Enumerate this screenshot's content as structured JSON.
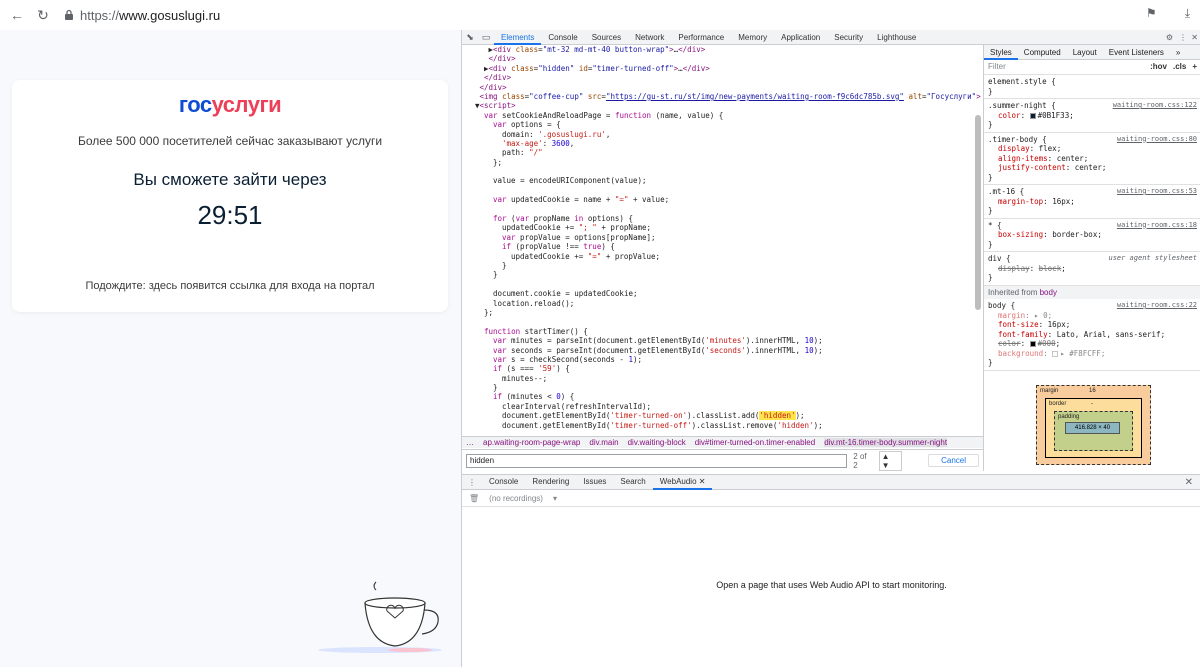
{
  "browser": {
    "url_protocol": "https://",
    "url_host": "www.gosuslugi.ru"
  },
  "page": {
    "logo_part1": "гос",
    "logo_part2": "услуги",
    "visitors_text": "Более 500 000 посетителей сейчас заказывают услуги",
    "enter_title": "Вы сможете зайти через",
    "timer": "29:51",
    "wait_text": "Подождите: здесь появится ссылка для входа на портал"
  },
  "devtools": {
    "tabs": [
      "Elements",
      "Console",
      "Sources",
      "Network",
      "Performance",
      "Memory",
      "Application",
      "Security",
      "Lighthouse"
    ],
    "active_tab": "Elements",
    "code_lines": [
      {
        "indent": 5,
        "html": "<span class=\"gt\">▶</span><span class=\"tag\">&lt;div</span> <span class=\"attr\">class</span>=<span class=\"val\">\"mt-32 md-mt-40 button-wrap\"</span><span class=\"tag\">&gt;</span>…<span class=\"tag\">&lt;/div&gt;</span>"
      },
      {
        "indent": 5,
        "html": "<span class=\"tag\">&lt;/div&gt;</span>"
      },
      {
        "indent": 4,
        "html": "<span class=\"gt\">▶</span><span class=\"tag\">&lt;div</span> <span class=\"attr\">class</span>=<span class=\"val\">\"hidden\"</span> <span class=\"attr\">id</span>=<span class=\"val\">\"timer-turned-off\"</span><span class=\"tag\">&gt;</span>…<span class=\"tag\">&lt;/div&gt;</span>"
      },
      {
        "indent": 4,
        "html": "<span class=\"tag\">&lt;/div&gt;</span>"
      },
      {
        "indent": 3,
        "html": "<span class=\"tag\">&lt;/div&gt;</span>"
      },
      {
        "indent": 3,
        "html": "<span class=\"tag\">&lt;img</span> <span class=\"attr\">class</span>=<span class=\"val\">\"coffee-cup\"</span> <span class=\"attr\">src</span>=<span class=\"val\"><u>\"https://gu-st.ru/st/img/new-payments/waiting-room-f9c6dc785b.svg\"</u></span> <span class=\"attr\">alt</span>=<span class=\"val\">\"Госуслуги\"</span><span class=\"tag\">&gt;</span>"
      },
      {
        "indent": 2,
        "html": "▼<span class=\"tag\">&lt;script&gt;</span>"
      },
      {
        "indent": 4,
        "html": "<span class=\"kw\">var</span> setCookieAndReloadPage = <span class=\"kw\">function</span> (name, value) {"
      },
      {
        "indent": 6,
        "html": "<span class=\"kw\">var</span> options = {"
      },
      {
        "indent": 8,
        "html": "domain: <span class=\"str\">'.gosuslugi.ru'</span>,"
      },
      {
        "indent": 8,
        "html": "<span class=\"str\">'max-age'</span>: <span class=\"num\">3600</span>,"
      },
      {
        "indent": 8,
        "html": "path: <span class=\"str\">\"/\"</span>"
      },
      {
        "indent": 6,
        "html": "};"
      },
      {
        "indent": 0,
        "html": ""
      },
      {
        "indent": 6,
        "html": "value = encodeURIComponent(value);"
      },
      {
        "indent": 0,
        "html": ""
      },
      {
        "indent": 6,
        "html": "<span class=\"kw\">var</span> updatedCookie = name + <span class=\"str\">\"=\"</span> + value;"
      },
      {
        "indent": 0,
        "html": ""
      },
      {
        "indent": 6,
        "html": "<span class=\"kw\">for</span> (<span class=\"kw\">var</span> propName <span class=\"kw\">in</span> options) {"
      },
      {
        "indent": 8,
        "html": "updatedCookie += <span class=\"str\">\"; \"</span> + propName;"
      },
      {
        "indent": 8,
        "html": "<span class=\"kw\">var</span> propValue = options[propName];"
      },
      {
        "indent": 8,
        "html": "<span class=\"kw\">if</span> (propValue !== <span class=\"kw\">true</span>) {"
      },
      {
        "indent": 10,
        "html": "updatedCookie += <span class=\"str\">\"=\"</span> + propValue;"
      },
      {
        "indent": 8,
        "html": "}"
      },
      {
        "indent": 6,
        "html": "}"
      },
      {
        "indent": 0,
        "html": ""
      },
      {
        "indent": 6,
        "html": "document.cookie = updatedCookie;"
      },
      {
        "indent": 6,
        "html": "location.reload();"
      },
      {
        "indent": 4,
        "html": "};"
      },
      {
        "indent": 0,
        "html": ""
      },
      {
        "indent": 4,
        "html": "<span class=\"kw\">function</span> startTimer() {"
      },
      {
        "indent": 6,
        "html": "<span class=\"kw\">var</span> minutes = parseInt(document.getElementById(<span class=\"str\">'minutes'</span>).innerHTML, <span class=\"num\">10</span>);"
      },
      {
        "indent": 6,
        "html": "<span class=\"kw\">var</span> seconds = parseInt(document.getElementById(<span class=\"str\">'seconds'</span>).innerHTML, <span class=\"num\">10</span>);"
      },
      {
        "indent": 6,
        "html": "<span class=\"kw\">var</span> s = checkSecond(seconds - <span class=\"num\">1</span>);"
      },
      {
        "indent": 6,
        "html": "<span class=\"kw\">if</span> (s === <span class=\"str\">'59'</span>) {"
      },
      {
        "indent": 8,
        "html": "minutes--;"
      },
      {
        "indent": 6,
        "html": "}"
      },
      {
        "indent": 6,
        "html": "<span class=\"kw\">if</span> (minutes &lt; <span class=\"num\">0</span>) {"
      },
      {
        "indent": 8,
        "html": "clearInterval(refreshIntervalId);"
      },
      {
        "indent": 8,
        "html": "document.getElementById(<span class=\"str\">'timer-turned-on'</span>).classList.add(<span class=\"str hl\">'hidden'</span>);"
      },
      {
        "indent": 8,
        "html": "document.getElementById(<span class=\"str\">'timer-turned-off'</span>).classList.remove(<span class=\"str\">'hidden'</span>);"
      }
    ],
    "breadcrumb": [
      "ap.waiting-room-page-wrap",
      "div.main",
      "div.waiting-block",
      "div#timer-turned-on.timer-enabled",
      "div.mt-16.timer-body.summer-night"
    ],
    "breadcrumb_more": "…",
    "search_value": "hidden",
    "search_match": "2 of 2",
    "search_arrows": "▲ ▼",
    "cancel_label": "Cancel",
    "styles_tabs": [
      "Styles",
      "Computed",
      "Layout",
      "Event Listeners",
      "»"
    ],
    "filter_placeholder": "Filter",
    "filter_tools": [
      ":hov",
      ".cls",
      "+"
    ],
    "rules": [
      {
        "selector": "element.style {",
        "source": "",
        "props": []
      },
      {
        "selector": ".summer-night {",
        "source": "waiting-room.css:122",
        "props": [
          {
            "name": "color",
            "value": "#0B1F33",
            "swatch": "#0b1f33"
          }
        ]
      },
      {
        "selector": ".timer-body {",
        "source": "waiting-room.css:80",
        "props": [
          {
            "name": "display",
            "value": "flex"
          },
          {
            "name": "align-items",
            "value": "center"
          },
          {
            "name": "justify-content",
            "value": "center"
          }
        ]
      },
      {
        "selector": ".mt-16 {",
        "source": "waiting-room.css:53",
        "props": [
          {
            "name": "margin-top",
            "value": "16px"
          }
        ]
      },
      {
        "selector": "* {",
        "source": "waiting-room.css:18",
        "props": [
          {
            "name": "box-sizing",
            "value": "border-box"
          }
        ]
      },
      {
        "selector": "div {",
        "source": "user agent stylesheet",
        "plain": true,
        "props": [
          {
            "name": "display",
            "value": "block",
            "struck": true
          }
        ]
      }
    ],
    "inherited_label": "Inherited from",
    "inherited_tag": "body",
    "body_rule": {
      "selector": "body {",
      "source": "waiting-room.css:22",
      "props": [
        {
          "name": "margin",
          "value": "▸ 0",
          "dim": true
        },
        {
          "name": "font-size",
          "value": "16px"
        },
        {
          "name": "font-family",
          "value": "Lato, Arial, sans-serif"
        },
        {
          "name": "color",
          "value": "#000",
          "struck": true,
          "swatch": "#000000"
        },
        {
          "name": "background",
          "value": "▸ #F8FCFF",
          "dim": true,
          "swatch": "#f8fcff"
        }
      ]
    },
    "boxmodel": {
      "margin_label": "margin",
      "margin_value": "16",
      "border_label": "border",
      "border_value": "-",
      "padding_label": "padding",
      "padding_value": "-",
      "content": "416.828 × 40"
    },
    "drawer_tabs": [
      "Console",
      "Rendering",
      "Issues",
      "Search",
      "WebAudio"
    ],
    "drawer_active": "WebAudio",
    "recordings_label": "(no recordings)",
    "webaudio_message": "Open a page that uses Web Audio API to start monitoring."
  }
}
